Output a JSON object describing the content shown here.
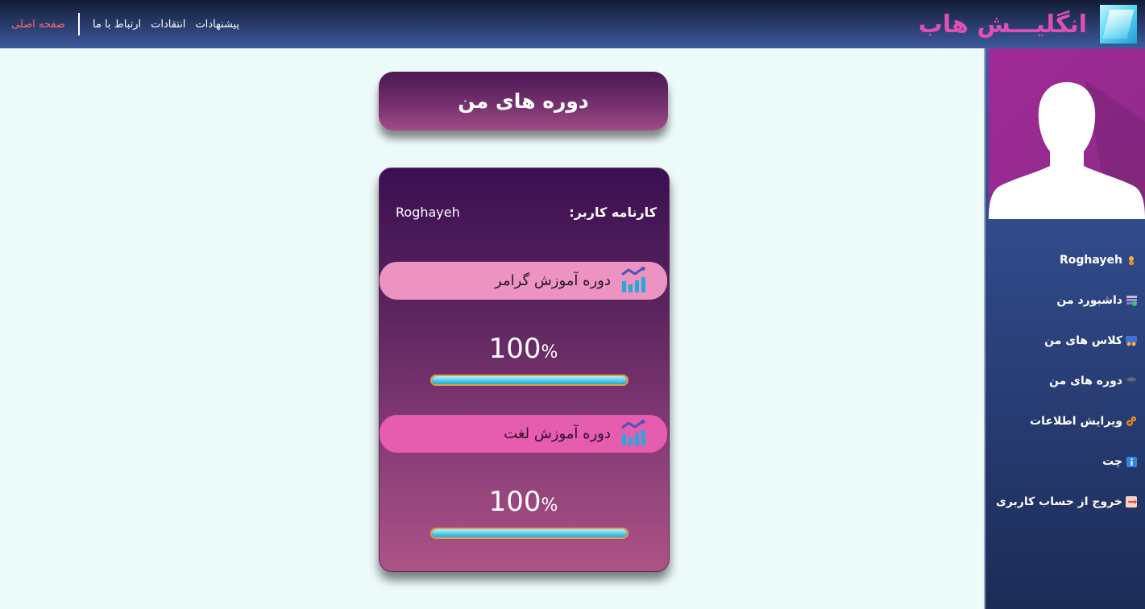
{
  "header": {
    "brand_title": "انگلیـــش هاب",
    "nav": {
      "home": "صفحه اصلی",
      "contact": "ارتباط با ما",
      "critiques": "انتقادات",
      "suggestions": "پیشنهادات"
    }
  },
  "sidebar": {
    "items": [
      {
        "label": "Roghayeh",
        "icon": "person-icon"
      },
      {
        "label": "داشبورد من",
        "icon": "dashboard-icon"
      },
      {
        "label": "کلاس های من",
        "icon": "classroom-icon"
      },
      {
        "label": "دوره های من",
        "icon": "graduation-cap-icon"
      },
      {
        "label": "ویرایش اطلاعات",
        "icon": "gears-icon"
      },
      {
        "label": "چت",
        "icon": "info-icon"
      },
      {
        "label": "خروج از حساب کاربری",
        "icon": "logout-icon"
      }
    ]
  },
  "main": {
    "title": "دوره های من",
    "report_label": "کارنامه کاربر:",
    "username": "Roghayeh",
    "courses": [
      {
        "name": "دوره آموزش گرامر",
        "progress_value": "100",
        "progress_sign": "%",
        "progress_fraction": 1.0
      },
      {
        "name": "دوره آموزش لغت",
        "progress_value": "100",
        "progress_sign": "%",
        "progress_fraction": 1.0
      }
    ]
  },
  "colors": {
    "brand": "#e04fb4",
    "home_link": "#ff6b6b",
    "pill_1": "#ec93c1",
    "pill_2": "#e65cae",
    "progress": "#4bc8ea"
  }
}
